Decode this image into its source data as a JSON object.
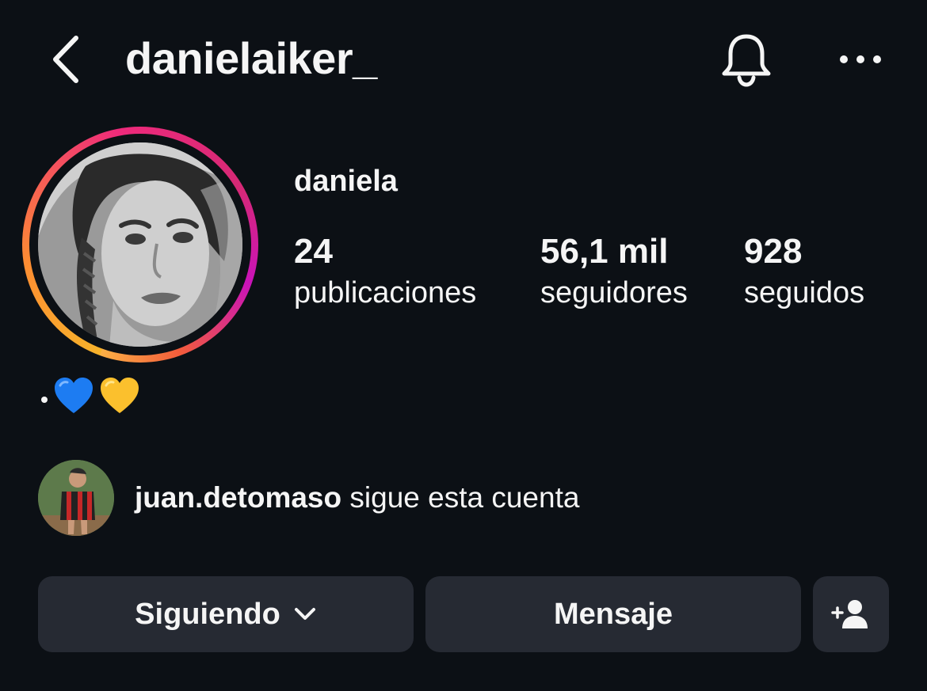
{
  "header": {
    "username": "danielaiker_",
    "back_icon": "chevron-left-icon",
    "bell_icon": "bell-icon",
    "more_icon": "more-horizontal-icon"
  },
  "profile": {
    "display_name": "daniela",
    "stats": [
      {
        "value": "24",
        "label": "publicaciones"
      },
      {
        "value": "56,1 mil",
        "label": "seguidores"
      },
      {
        "value": "928",
        "label": "seguidos"
      }
    ],
    "bio_emojis": [
      "blue-heart",
      "yellow-heart"
    ],
    "story_ring_colors": [
      "#fcb045",
      "#fd8d32",
      "#ee2a7b",
      "#c913b9"
    ]
  },
  "followed_by": {
    "username": "juan.detomaso",
    "text": "sigue esta cuenta"
  },
  "actions": {
    "following_label": "Siguiendo",
    "message_label": "Mensaje",
    "add_icon": "add-person-icon"
  },
  "colors": {
    "background": "#0c1015",
    "button": "#262a33",
    "text": "#f5f5f5",
    "blue_heart": "#1d7cf2",
    "yellow_heart": "#fbc02d"
  }
}
